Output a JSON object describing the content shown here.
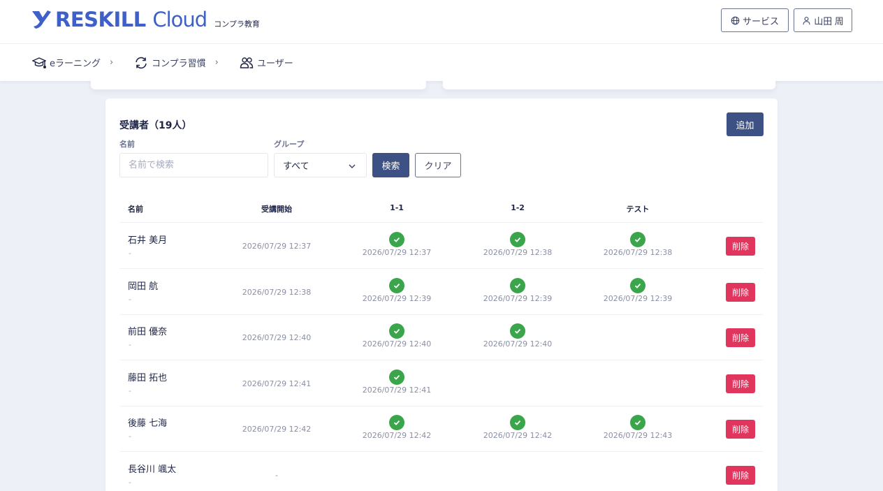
{
  "header": {
    "logo_text": "RESKILL",
    "logo_text2": "Cloud",
    "logo_sub": "コンプラ教育",
    "service_label": "サービス",
    "user_label": "山田 周"
  },
  "nav": {
    "items": [
      {
        "label": "eラーニング",
        "icon": "graduation-cap-icon"
      },
      {
        "label": "コンプラ習慣",
        "icon": "refresh-icon"
      },
      {
        "label": "ユーザー",
        "icon": "users-icon"
      }
    ]
  },
  "card": {
    "title": "受講者（19人）",
    "add_label": "追加",
    "name_label": "名前",
    "name_placeholder": "名前で検索",
    "group_label": "グループ",
    "group_selected": "すべて",
    "search_label": "検索",
    "clear_label": "クリア"
  },
  "table": {
    "headers": [
      "名前",
      "受講開始",
      "1-1",
      "1-2",
      "テスト"
    ],
    "delete_label": "削除",
    "rows": [
      {
        "name": "石井 美月",
        "sub": "-",
        "start": "2026/07/29 12:37",
        "progress": [
          "2026/07/29 12:37",
          "2026/07/29 12:38",
          "2026/07/29 12:38"
        ]
      },
      {
        "name": "岡田 航",
        "sub": "-",
        "start": "2026/07/29 12:38",
        "progress": [
          "2026/07/29 12:39",
          "2026/07/29 12:39",
          "2026/07/29 12:39"
        ]
      },
      {
        "name": "前田 優奈",
        "sub": "-",
        "start": "2026/07/29 12:40",
        "progress": [
          "2026/07/29 12:40",
          "2026/07/29 12:40",
          null
        ]
      },
      {
        "name": "藤田 拓也",
        "sub": "-",
        "start": "2026/07/29 12:41",
        "progress": [
          "2026/07/29 12:41",
          null,
          null
        ]
      },
      {
        "name": "後藤 七海",
        "sub": "-",
        "start": "2026/07/29 12:42",
        "progress": [
          "2026/07/29 12:42",
          "2026/07/29 12:42",
          "2026/07/29 12:43"
        ]
      },
      {
        "name": "長谷川 颯太",
        "sub": "-",
        "start": "-",
        "progress": [
          null,
          null,
          null
        ]
      }
    ]
  },
  "colors": {
    "primary": "#3d5185",
    "danger": "#e0365d",
    "success": "#3aa54a",
    "brand": "#3f5fc9"
  }
}
